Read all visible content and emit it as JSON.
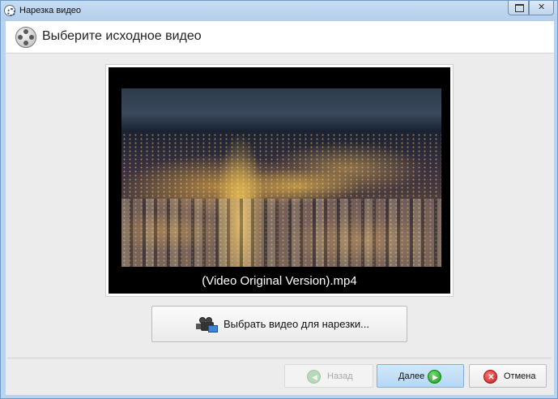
{
  "window": {
    "title": "Нарезка видео",
    "icons": {
      "app": "film-reel-icon",
      "maximize": "maximize-icon",
      "close": "close-icon"
    }
  },
  "header": {
    "title": "Выберите исходное видео",
    "icon": "film-reel-icon"
  },
  "preview": {
    "filename": "(Video Original Version).mp4",
    "thumbnail_description_icon": "video-thumbnail"
  },
  "actions": {
    "select_video_label": "Выбрать видео для нарезки...",
    "select_video_icon": "video-camera-icon"
  },
  "footer": {
    "back_label": "Назад",
    "back_enabled": false,
    "next_label": "Далее",
    "cancel_label": "Отмена"
  },
  "colors": {
    "next_button": "#b7d7f3",
    "next_icon": "#1e9a1e",
    "cancel_icon": "#c81e1e",
    "title_bar": "#b9d4ee"
  }
}
